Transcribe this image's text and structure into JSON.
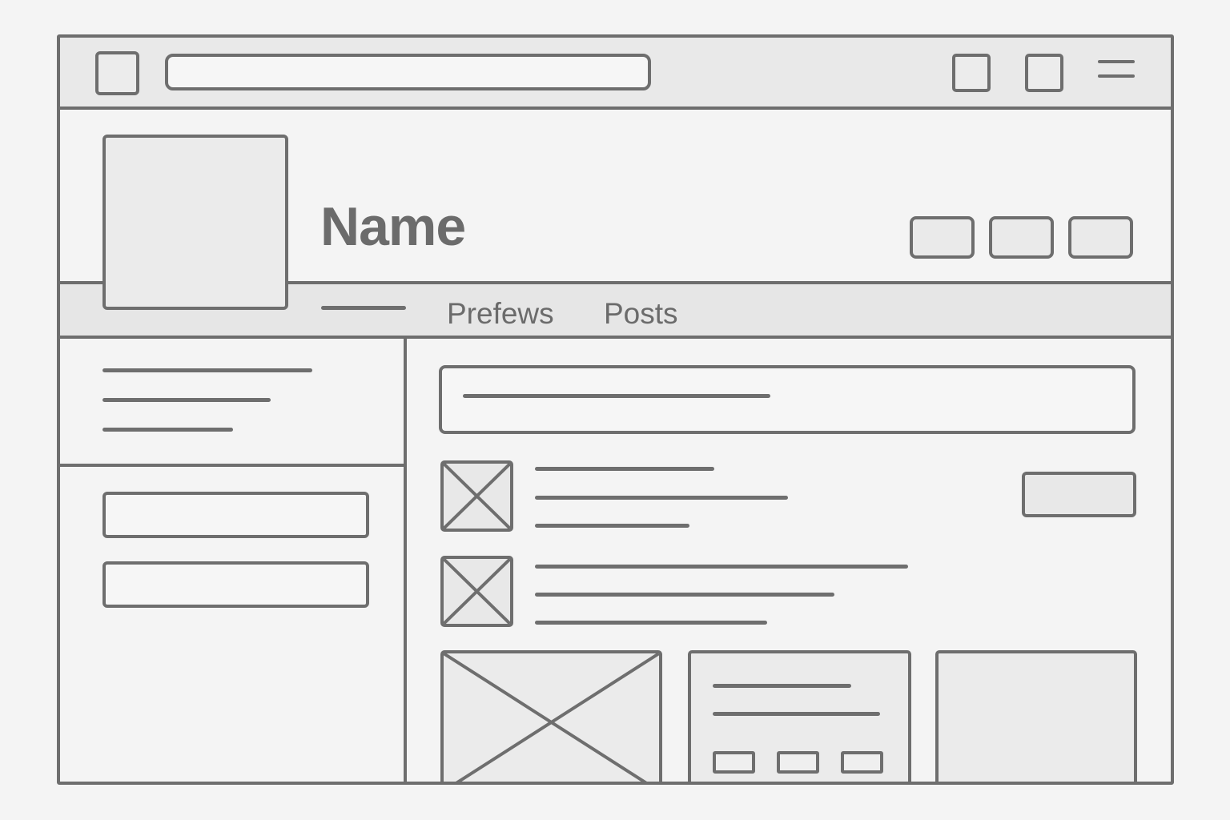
{
  "browser": {
    "address_bar": "",
    "menu_icon": "hamburger-menu-icon"
  },
  "profile": {
    "name": "Name"
  },
  "tabs": [
    {
      "label": ""
    },
    {
      "label": "Prefews"
    },
    {
      "label": "Posts"
    }
  ],
  "main": {
    "composer_text": "",
    "feed_items": [
      {
        "image": "placeholder-image-icon"
      },
      {
        "image": "placeholder-image-icon"
      }
    ]
  },
  "colors": {
    "stroke": "#6e6e6e",
    "background": "#f4f4f4",
    "fill": "#e9e9e9"
  }
}
